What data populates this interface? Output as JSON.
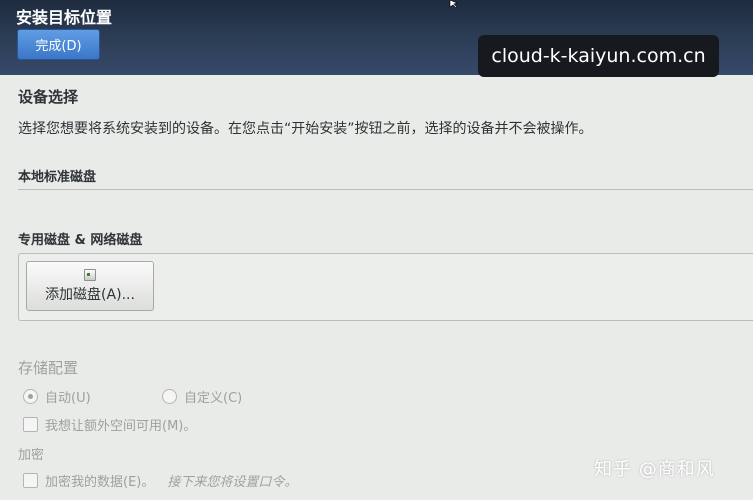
{
  "header": {
    "title": "安装目标位置",
    "done_label": "完成(D)",
    "keyboard_indicator": "cloud-k-kaiyun.com.cn"
  },
  "device_selection": {
    "title": "设备选择",
    "description": "选择您想要将系统安装到的设备。在您点击“开始安装”按钮之前，选择的设备并不会被操作。",
    "local_disks_label": "本地标准磁盘",
    "special_disks_label": "专用磁盘 & 网络磁盘",
    "add_disk_label": "添加磁盘(A)..."
  },
  "storage_config": {
    "title": "存储配置",
    "auto_label": "自动(U)",
    "custom_label": "自定义(C)",
    "selected": "auto",
    "extra_space_label": "我想让额外空间可用(M)。"
  },
  "encryption": {
    "title": "加密",
    "encrypt_label": "加密我的数据(E)。",
    "encrypt_note": "接下来您将设置口令。"
  },
  "watermark": "知乎 @商和风"
}
